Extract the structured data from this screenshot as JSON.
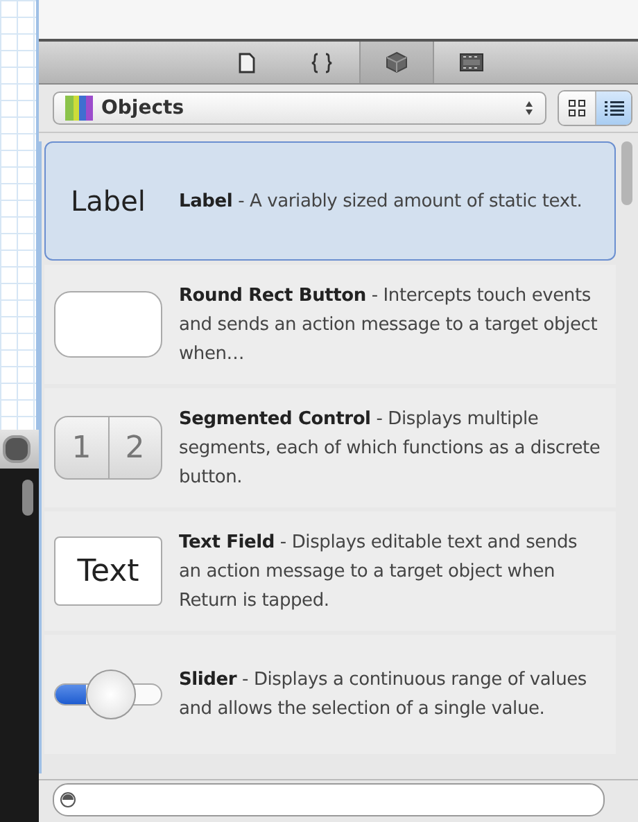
{
  "toolbar": {
    "tabs": [
      {
        "kind": "file",
        "selected": false
      },
      {
        "kind": "braces",
        "selected": false
      },
      {
        "kind": "cube",
        "selected": true
      },
      {
        "kind": "media",
        "selected": false
      }
    ]
  },
  "library": {
    "value": "Objects",
    "views": [
      {
        "kind": "grid",
        "selected": false
      },
      {
        "kind": "list",
        "selected": true
      }
    ]
  },
  "items": [
    {
      "kind": "label",
      "preview": [
        "Label"
      ],
      "description": "**Label** - A variably sized amount of static text.",
      "selected": true
    },
    {
      "kind": "button",
      "description": "**Round Rect Button** - Intercepts touch events and sends an action message to a target object when…",
      "selected": false
    },
    {
      "kind": "segmented",
      "preview": [
        "1",
        "2"
      ],
      "description": "**Segmented Control** - Displays multiple segments, each of which functions as a discrete button.",
      "selected": false
    },
    {
      "kind": "textfield",
      "preview": [
        "Text"
      ],
      "description": "**Text Field** - Displays editable text and sends an action message to a target object when Return is tapped.",
      "selected": false
    },
    {
      "kind": "slider",
      "level": 0.53,
      "description": "**Slider** - Displays a continuous range of values and allows the selection of a single value.",
      "selected": false
    }
  ]
}
